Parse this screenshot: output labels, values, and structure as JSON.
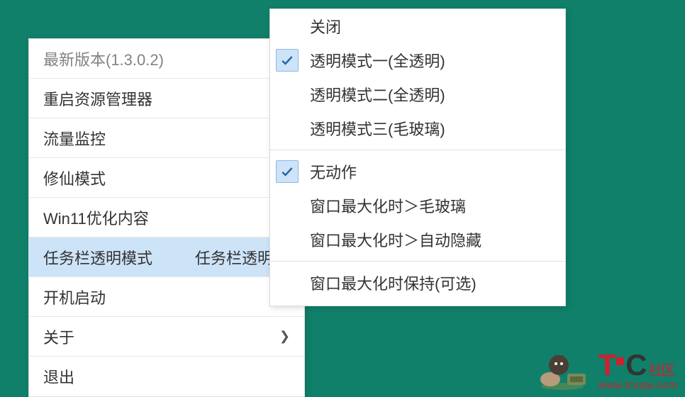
{
  "left_menu": {
    "version": "最新版本(1.3.0.2)",
    "restart_explorer": "重启资源管理器",
    "traffic_monitor": "流量监控",
    "xiuxian_mode": "修仙模式",
    "win11_optimize": "Win11优化内容",
    "taskbar_transparent": "任务栏透明模式",
    "taskbar_transparent_extra": "任务栏透明模",
    "startup": "开机启动",
    "about": "关于",
    "exit": "退出"
  },
  "right_menu": {
    "close": "关闭",
    "mode1": "透明模式一(全透明)",
    "mode2": "透明模式二(全透明)",
    "mode3": "透明模式三(毛玻璃)",
    "no_action": "无动作",
    "maximize_glass": "窗口最大化时＞毛玻璃",
    "maximize_hide": "窗口最大化时＞自动隐藏",
    "maximize_keep": "窗口最大化时保持(可选)"
  },
  "watermark": {
    "brand_t": "T",
    "brand_c": "C",
    "brand_cn": "社区",
    "url": "www.tcsqw.com"
  }
}
